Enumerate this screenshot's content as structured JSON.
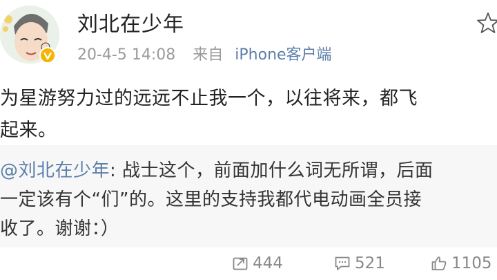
{
  "user": {
    "name": "刘北在少年",
    "verified": true
  },
  "meta": {
    "time": "20-4-5 14:08",
    "source_prefix": "来自",
    "source": "iPhone客户端"
  },
  "post": {
    "line1": "为星游努力过的远远不止我一个，以往将来，都飞",
    "line2": "起来。"
  },
  "repost": {
    "mention": "@刘北在少年",
    "line1_rest": ": 战士这个，前面加什么词无所谓，后面",
    "line2": "一定该有个“们”的。这里的支持我都代电动画全员接",
    "line3": "收了。谢谢：）"
  },
  "actions": {
    "reposts": "444",
    "comments": "521",
    "likes": "1105"
  },
  "icons": {
    "favorite": "star-outline-icon",
    "repost": "repost-icon",
    "comment": "comment-icon",
    "like": "thumbs-up-icon"
  },
  "colors": {
    "link": "#5b7ea8",
    "verified_badge": "#f4b400",
    "muted": "#9a9a9a"
  }
}
